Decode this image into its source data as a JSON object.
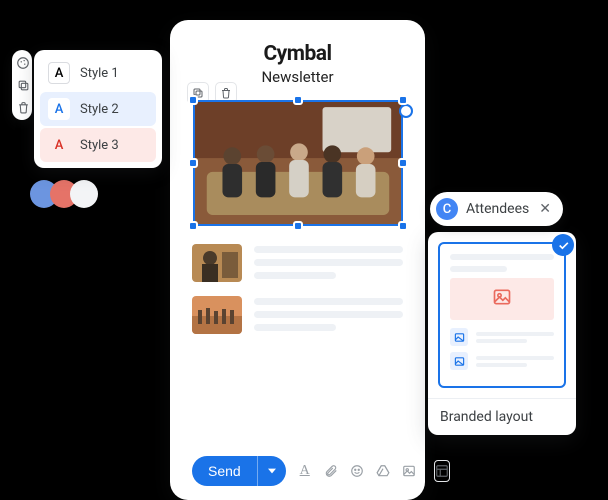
{
  "brand_title": "Cymbal",
  "doc_title": "Newsletter",
  "styles": {
    "items": [
      {
        "label": "Style 1",
        "glyph": "A"
      },
      {
        "label": "Style 2",
        "glyph": "A"
      },
      {
        "label": "Style 3",
        "glyph": "A"
      }
    ]
  },
  "palette": {
    "colors": [
      "#6c95e0",
      "#e57368",
      "#f3f4f6"
    ]
  },
  "chip": {
    "avatar_letter": "C",
    "label": "Attendees"
  },
  "layout_card": {
    "label": "Branded layout"
  },
  "toolbar": {
    "send_label": "Send"
  },
  "icons": {
    "copy": "copy-icon",
    "trash": "trash-icon",
    "palette": "palette-icon",
    "format": "format-icon",
    "attach": "attach-icon",
    "emoji": "emoji-icon",
    "drive": "drive-icon",
    "image": "image-icon",
    "layout": "layout-icon",
    "check": "check-icon",
    "close": "close-icon",
    "rotate": "rotate-icon",
    "caret": "caret-down-icon"
  }
}
